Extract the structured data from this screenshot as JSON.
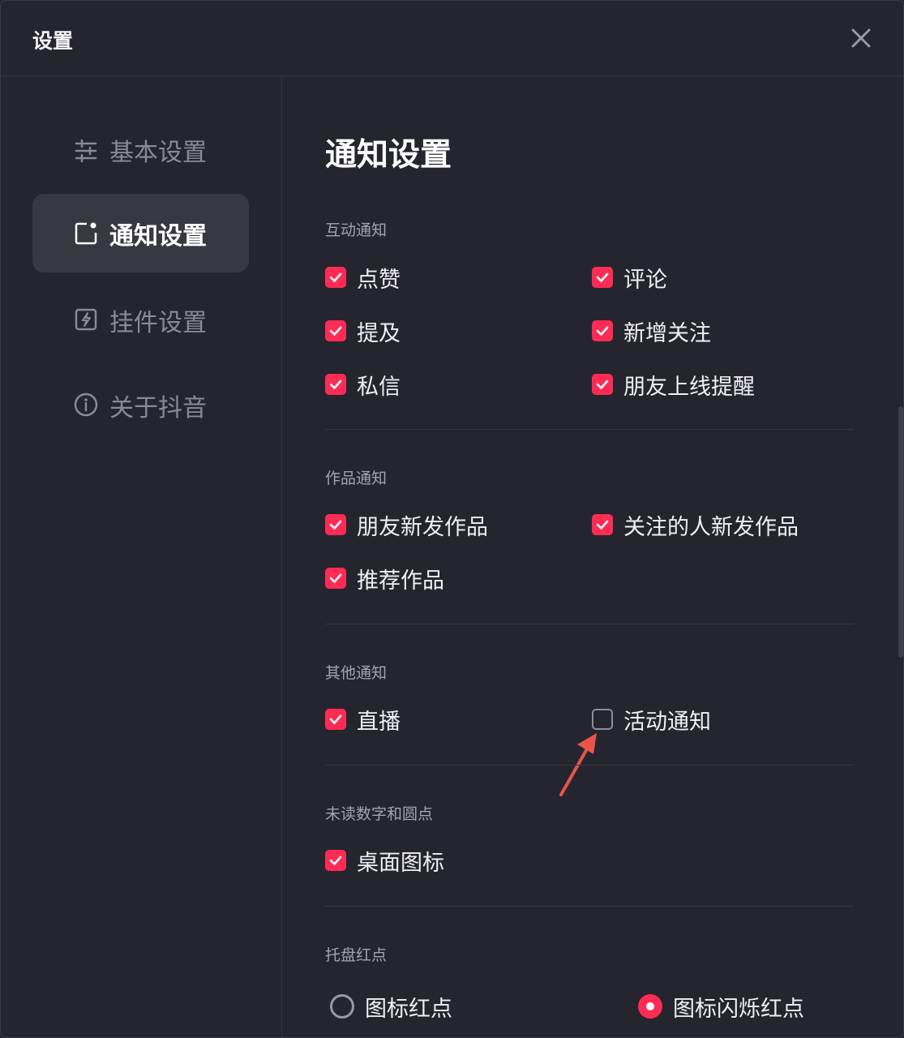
{
  "window": {
    "title": "设置"
  },
  "sidebar": {
    "items": [
      {
        "label": "基本设置",
        "icon": "sliders-icon",
        "active": false
      },
      {
        "label": "通知设置",
        "icon": "notification-icon",
        "active": true
      },
      {
        "label": "挂件设置",
        "icon": "widget-icon",
        "active": false
      },
      {
        "label": "关于抖音",
        "icon": "info-icon",
        "active": false
      }
    ]
  },
  "main": {
    "title": "通知设置",
    "sections": {
      "interaction": {
        "title": "互动通知",
        "options": [
          {
            "label": "点赞",
            "checked": true
          },
          {
            "label": "评论",
            "checked": true
          },
          {
            "label": "提及",
            "checked": true
          },
          {
            "label": "新增关注",
            "checked": true
          },
          {
            "label": "私信",
            "checked": true
          },
          {
            "label": "朋友上线提醒",
            "checked": true
          }
        ]
      },
      "works": {
        "title": "作品通知",
        "options": [
          {
            "label": "朋友新发作品",
            "checked": true
          },
          {
            "label": "关注的人新发作品",
            "checked": true
          },
          {
            "label": "推荐作品",
            "checked": true
          }
        ]
      },
      "other": {
        "title": "其他通知",
        "options": [
          {
            "label": "直播",
            "checked": true
          },
          {
            "label": "活动通知",
            "checked": false
          }
        ]
      },
      "unread": {
        "title": "未读数字和圆点",
        "options": [
          {
            "label": "桌面图标",
            "checked": true
          }
        ]
      },
      "tray": {
        "title": "托盘红点",
        "options": [
          {
            "label": "图标红点",
            "selected": false
          },
          {
            "label": "图标闪烁红点",
            "selected": true
          }
        ]
      }
    }
  },
  "colors": {
    "accent": "#fe2c55",
    "background": "#25252f",
    "annotation_arrow": "#e8544a"
  }
}
